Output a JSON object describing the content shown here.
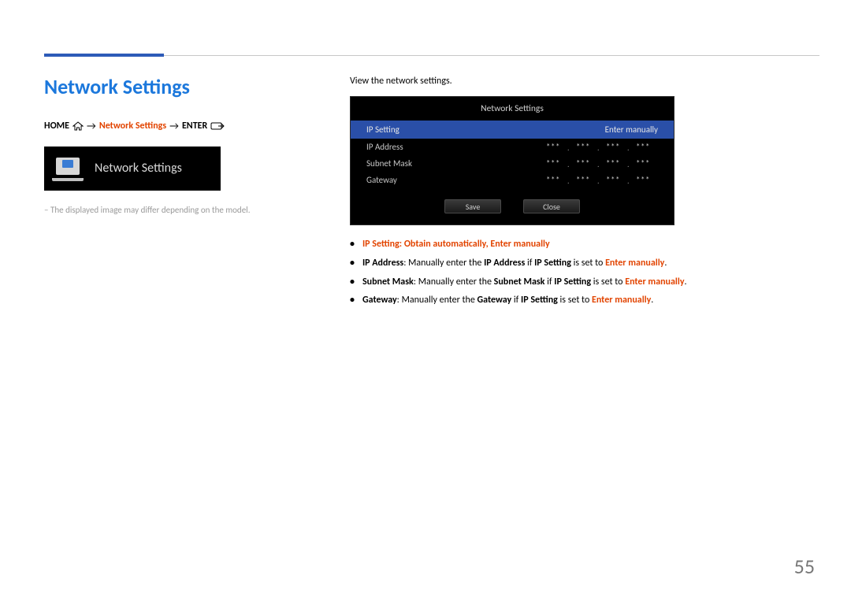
{
  "page_number": "55",
  "heading": "Network Settings",
  "breadcrumb": {
    "home": "HOME",
    "arrow1": "→",
    "middle": "Network Settings",
    "arrow2": "→",
    "enter": "ENTER"
  },
  "tile_label": "Network Settings",
  "footnote": "The displayed image may differ depending on the model.",
  "intro": "View the network settings.",
  "dialog": {
    "title": "Network Settings",
    "header_key": "IP Setting",
    "header_value": "Enter manually",
    "rows": [
      {
        "k": "IP Address",
        "v": [
          "***",
          "***",
          "***",
          "***"
        ]
      },
      {
        "k": "Subnet Mask",
        "v": [
          "***",
          "***",
          "***",
          "***"
        ]
      },
      {
        "k": "Gateway",
        "v": [
          "***",
          "***",
          "***",
          "***"
        ]
      }
    ],
    "save": "Save",
    "close": "Close"
  },
  "bullets": {
    "b1": {
      "k": "IP Setting",
      "sep": ": ",
      "v1": "Obtain automatically",
      "comma": ", ",
      "v2": "Enter manually"
    },
    "b2": {
      "k": "IP Address",
      "t1": ": Manually enter the ",
      "k2": "IP Address",
      "t2": " if ",
      "k3": "IP Setting",
      "t3": " is set to ",
      "v": "Enter manually",
      "dot": "."
    },
    "b3": {
      "k": "Subnet Mask",
      "t1": ": Manually enter the ",
      "k2": "Subnet Mask",
      "t2": " if ",
      "k3": "IP Setting",
      "t3": " is set to ",
      "v": "Enter manually",
      "dot": "."
    },
    "b4": {
      "k": "Gateway",
      "t1": ": Manually enter the ",
      "k2": "Gateway",
      "t2": " if ",
      "k3": "IP Setting",
      "t3": " is set to ",
      "v": "Enter manually",
      "dot": "."
    }
  }
}
